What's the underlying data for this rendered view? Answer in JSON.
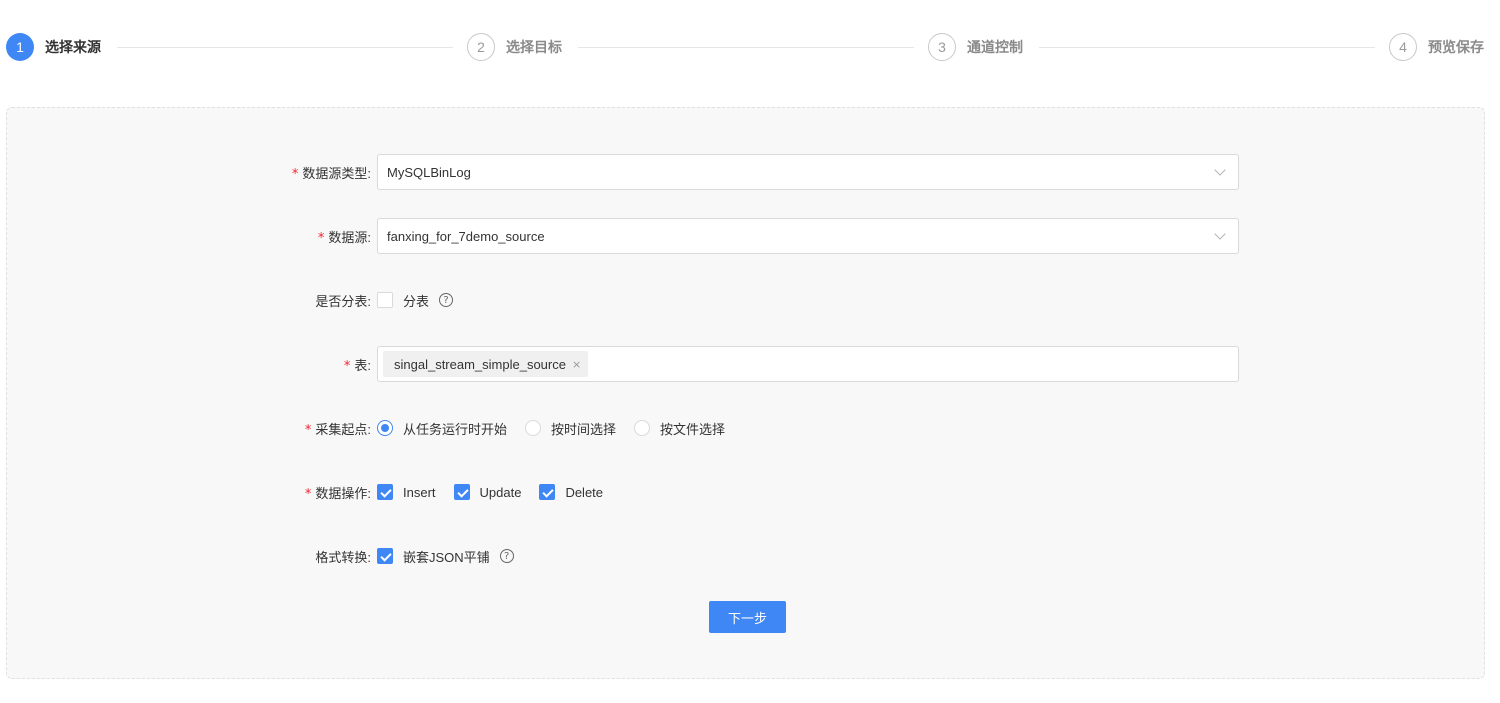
{
  "steps": [
    {
      "num": "1",
      "title": "选择来源",
      "status": "active"
    },
    {
      "num": "2",
      "title": "选择目标",
      "status": "wait"
    },
    {
      "num": "3",
      "title": "通道控制",
      "status": "wait"
    },
    {
      "num": "4",
      "title": "预览保存",
      "status": "wait"
    }
  ],
  "form": {
    "source_type": {
      "required": "*",
      "label": "数据源类型:",
      "value": "MySQLBinLog"
    },
    "source": {
      "required": "*",
      "label": "数据源:",
      "value": "fanxing_for_7demo_source"
    },
    "sharding": {
      "label": "是否分表:",
      "option": "分表",
      "checked": false,
      "help": "?"
    },
    "table": {
      "required": "*",
      "label": "表:",
      "tags": [
        "singal_stream_simple_source"
      ],
      "tag_close": "×"
    },
    "start_point": {
      "required": "*",
      "label": "采集起点:",
      "options": [
        "从任务运行时开始",
        "按时间选择",
        "按文件选择"
      ],
      "selected": "从任务运行时开始"
    },
    "operations": {
      "required": "*",
      "label": "数据操作:",
      "options": [
        "Insert",
        "Update",
        "Delete"
      ],
      "checked": [
        true,
        true,
        true
      ]
    },
    "format": {
      "label": "格式转换:",
      "option": "嵌套JSON平铺",
      "checked": true,
      "help": "?"
    }
  },
  "next_button": "下一步",
  "colors": {
    "primary": "#3f87f5",
    "required": "#f5222d",
    "card_bg": "#f8f8f8"
  }
}
